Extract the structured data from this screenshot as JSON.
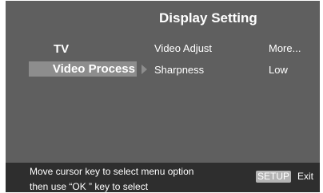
{
  "menu": {
    "title": "Display Setting"
  },
  "categories": {
    "tv": "TV",
    "video_process": "Video Process"
  },
  "settings": [
    {
      "name": "Video Adjust",
      "value": "More..."
    },
    {
      "name": "Sharpness",
      "value": "Low"
    }
  ],
  "footer": {
    "help_line_1": "Move cursor key to select menu option",
    "help_line_2": "then use “OK ” key to select",
    "setup_key": "SETUP",
    "exit_label": "Exit"
  },
  "colors": {
    "screen_background": "#5f5f5f",
    "highlight": "#8d8d8d",
    "footer_background": "#2e2e2e",
    "setup_key_background": "#b4b4b4",
    "text": "#ffffff"
  },
  "icons": {
    "selection_arrow": "arrow-right-icon"
  }
}
